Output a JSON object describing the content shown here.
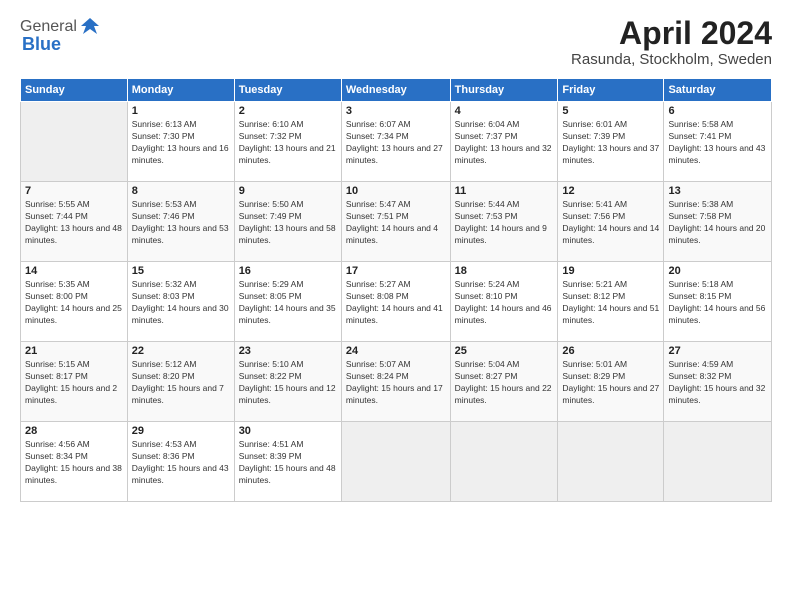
{
  "header": {
    "logo": {
      "general": "General",
      "blue": "Blue"
    },
    "title": "April 2024",
    "location": "Rasunda, Stockholm, Sweden"
  },
  "weekdays": [
    "Sunday",
    "Monday",
    "Tuesday",
    "Wednesday",
    "Thursday",
    "Friday",
    "Saturday"
  ],
  "weeks": [
    [
      {
        "day": "",
        "sunrise": "",
        "sunset": "",
        "daylight": ""
      },
      {
        "day": "1",
        "sunrise": "Sunrise: 6:13 AM",
        "sunset": "Sunset: 7:30 PM",
        "daylight": "Daylight: 13 hours and 16 minutes."
      },
      {
        "day": "2",
        "sunrise": "Sunrise: 6:10 AM",
        "sunset": "Sunset: 7:32 PM",
        "daylight": "Daylight: 13 hours and 21 minutes."
      },
      {
        "day": "3",
        "sunrise": "Sunrise: 6:07 AM",
        "sunset": "Sunset: 7:34 PM",
        "daylight": "Daylight: 13 hours and 27 minutes."
      },
      {
        "day": "4",
        "sunrise": "Sunrise: 6:04 AM",
        "sunset": "Sunset: 7:37 PM",
        "daylight": "Daylight: 13 hours and 32 minutes."
      },
      {
        "day": "5",
        "sunrise": "Sunrise: 6:01 AM",
        "sunset": "Sunset: 7:39 PM",
        "daylight": "Daylight: 13 hours and 37 minutes."
      },
      {
        "day": "6",
        "sunrise": "Sunrise: 5:58 AM",
        "sunset": "Sunset: 7:41 PM",
        "daylight": "Daylight: 13 hours and 43 minutes."
      }
    ],
    [
      {
        "day": "7",
        "sunrise": "Sunrise: 5:55 AM",
        "sunset": "Sunset: 7:44 PM",
        "daylight": "Daylight: 13 hours and 48 minutes."
      },
      {
        "day": "8",
        "sunrise": "Sunrise: 5:53 AM",
        "sunset": "Sunset: 7:46 PM",
        "daylight": "Daylight: 13 hours and 53 minutes."
      },
      {
        "day": "9",
        "sunrise": "Sunrise: 5:50 AM",
        "sunset": "Sunset: 7:49 PM",
        "daylight": "Daylight: 13 hours and 58 minutes."
      },
      {
        "day": "10",
        "sunrise": "Sunrise: 5:47 AM",
        "sunset": "Sunset: 7:51 PM",
        "daylight": "Daylight: 14 hours and 4 minutes."
      },
      {
        "day": "11",
        "sunrise": "Sunrise: 5:44 AM",
        "sunset": "Sunset: 7:53 PM",
        "daylight": "Daylight: 14 hours and 9 minutes."
      },
      {
        "day": "12",
        "sunrise": "Sunrise: 5:41 AM",
        "sunset": "Sunset: 7:56 PM",
        "daylight": "Daylight: 14 hours and 14 minutes."
      },
      {
        "day": "13",
        "sunrise": "Sunrise: 5:38 AM",
        "sunset": "Sunset: 7:58 PM",
        "daylight": "Daylight: 14 hours and 20 minutes."
      }
    ],
    [
      {
        "day": "14",
        "sunrise": "Sunrise: 5:35 AM",
        "sunset": "Sunset: 8:00 PM",
        "daylight": "Daylight: 14 hours and 25 minutes."
      },
      {
        "day": "15",
        "sunrise": "Sunrise: 5:32 AM",
        "sunset": "Sunset: 8:03 PM",
        "daylight": "Daylight: 14 hours and 30 minutes."
      },
      {
        "day": "16",
        "sunrise": "Sunrise: 5:29 AM",
        "sunset": "Sunset: 8:05 PM",
        "daylight": "Daylight: 14 hours and 35 minutes."
      },
      {
        "day": "17",
        "sunrise": "Sunrise: 5:27 AM",
        "sunset": "Sunset: 8:08 PM",
        "daylight": "Daylight: 14 hours and 41 minutes."
      },
      {
        "day": "18",
        "sunrise": "Sunrise: 5:24 AM",
        "sunset": "Sunset: 8:10 PM",
        "daylight": "Daylight: 14 hours and 46 minutes."
      },
      {
        "day": "19",
        "sunrise": "Sunrise: 5:21 AM",
        "sunset": "Sunset: 8:12 PM",
        "daylight": "Daylight: 14 hours and 51 minutes."
      },
      {
        "day": "20",
        "sunrise": "Sunrise: 5:18 AM",
        "sunset": "Sunset: 8:15 PM",
        "daylight": "Daylight: 14 hours and 56 minutes."
      }
    ],
    [
      {
        "day": "21",
        "sunrise": "Sunrise: 5:15 AM",
        "sunset": "Sunset: 8:17 PM",
        "daylight": "Daylight: 15 hours and 2 minutes."
      },
      {
        "day": "22",
        "sunrise": "Sunrise: 5:12 AM",
        "sunset": "Sunset: 8:20 PM",
        "daylight": "Daylight: 15 hours and 7 minutes."
      },
      {
        "day": "23",
        "sunrise": "Sunrise: 5:10 AM",
        "sunset": "Sunset: 8:22 PM",
        "daylight": "Daylight: 15 hours and 12 minutes."
      },
      {
        "day": "24",
        "sunrise": "Sunrise: 5:07 AM",
        "sunset": "Sunset: 8:24 PM",
        "daylight": "Daylight: 15 hours and 17 minutes."
      },
      {
        "day": "25",
        "sunrise": "Sunrise: 5:04 AM",
        "sunset": "Sunset: 8:27 PM",
        "daylight": "Daylight: 15 hours and 22 minutes."
      },
      {
        "day": "26",
        "sunrise": "Sunrise: 5:01 AM",
        "sunset": "Sunset: 8:29 PM",
        "daylight": "Daylight: 15 hours and 27 minutes."
      },
      {
        "day": "27",
        "sunrise": "Sunrise: 4:59 AM",
        "sunset": "Sunset: 8:32 PM",
        "daylight": "Daylight: 15 hours and 32 minutes."
      }
    ],
    [
      {
        "day": "28",
        "sunrise": "Sunrise: 4:56 AM",
        "sunset": "Sunset: 8:34 PM",
        "daylight": "Daylight: 15 hours and 38 minutes."
      },
      {
        "day": "29",
        "sunrise": "Sunrise: 4:53 AM",
        "sunset": "Sunset: 8:36 PM",
        "daylight": "Daylight: 15 hours and 43 minutes."
      },
      {
        "day": "30",
        "sunrise": "Sunrise: 4:51 AM",
        "sunset": "Sunset: 8:39 PM",
        "daylight": "Daylight: 15 hours and 48 minutes."
      },
      {
        "day": "",
        "sunrise": "",
        "sunset": "",
        "daylight": ""
      },
      {
        "day": "",
        "sunrise": "",
        "sunset": "",
        "daylight": ""
      },
      {
        "day": "",
        "sunrise": "",
        "sunset": "",
        "daylight": ""
      },
      {
        "day": "",
        "sunrise": "",
        "sunset": "",
        "daylight": ""
      }
    ]
  ]
}
